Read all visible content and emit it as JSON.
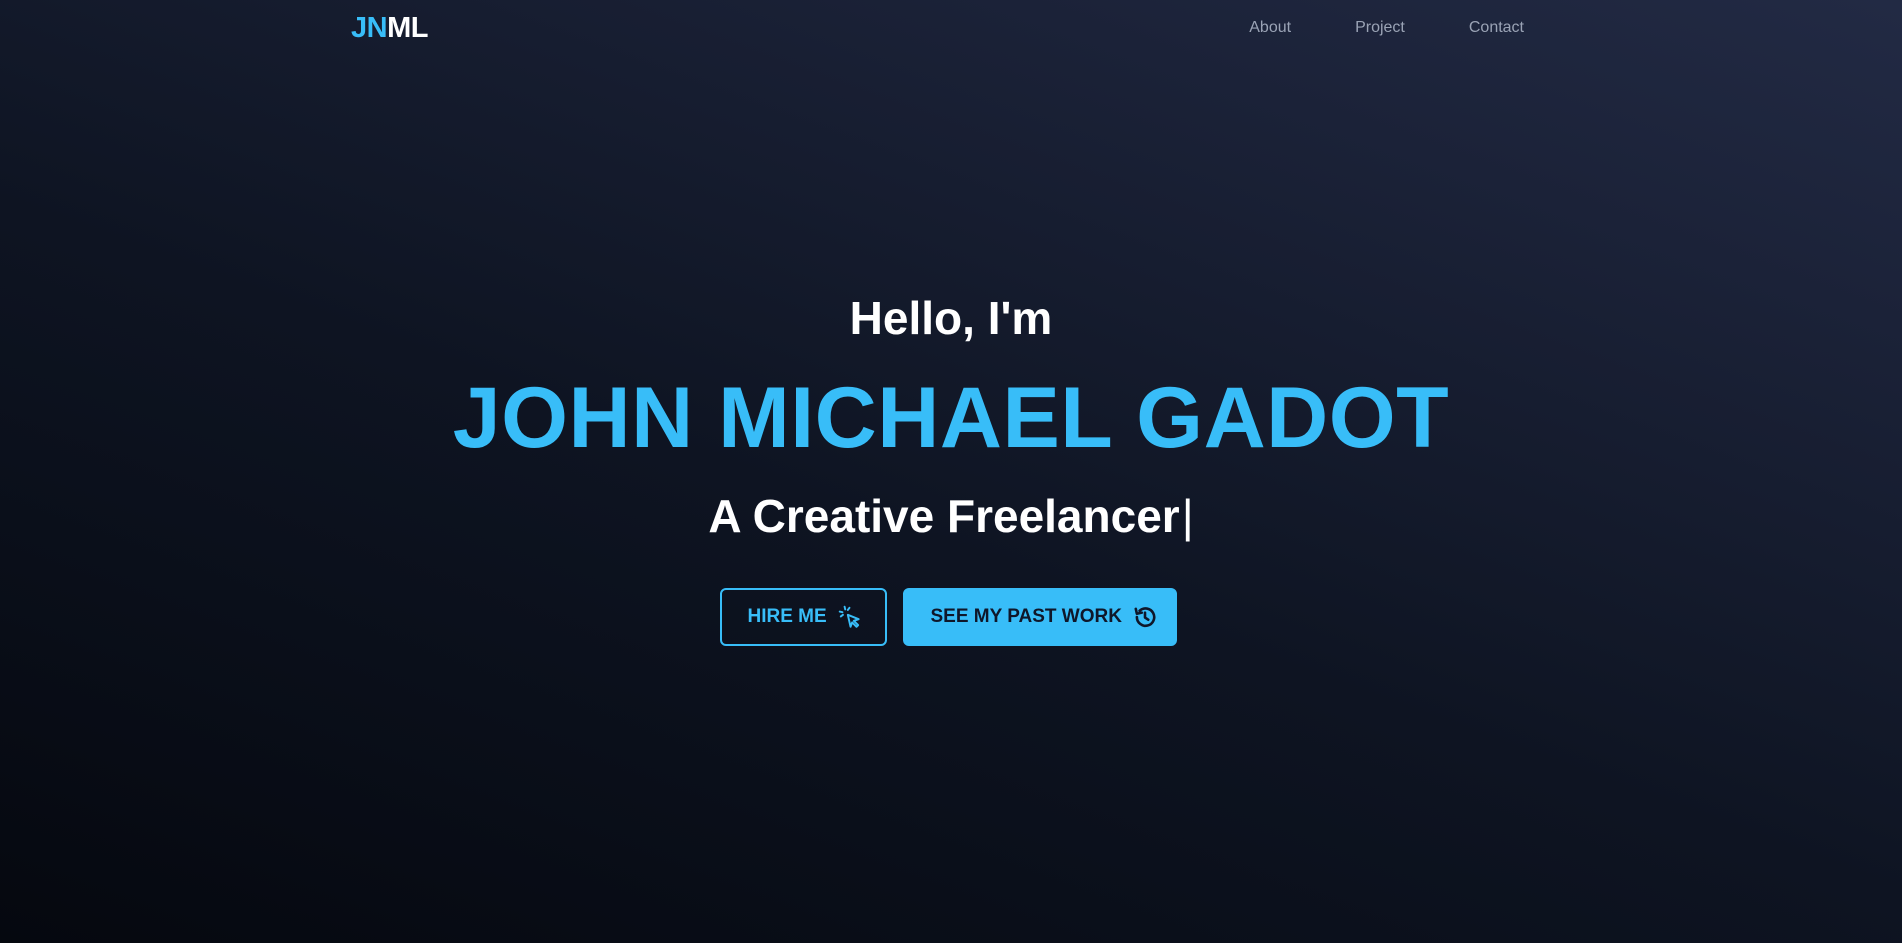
{
  "brand": {
    "logo_accent": "JN",
    "logo_rest": "ML",
    "accent_color": "#38bdf8"
  },
  "nav": {
    "items": [
      {
        "label": "About"
      },
      {
        "label": "Project"
      },
      {
        "label": "Contact"
      }
    ]
  },
  "hero": {
    "greeting": "Hello, I'm",
    "name": "JOHN MICHAEL GADOT",
    "role": "A Creative Freelancer",
    "cursor": "|"
  },
  "actions": {
    "hire": {
      "label": "HIRE ME",
      "icon": "cursor-click-icon"
    },
    "work": {
      "label": "SEE MY PAST WORK",
      "icon": "history-icon"
    }
  },
  "colors": {
    "background_dark": "#05080f",
    "background_light": "#222a44",
    "text_primary": "#ffffff",
    "nav_text": "#9aa3b5",
    "button_dark_text": "#0f172a"
  }
}
